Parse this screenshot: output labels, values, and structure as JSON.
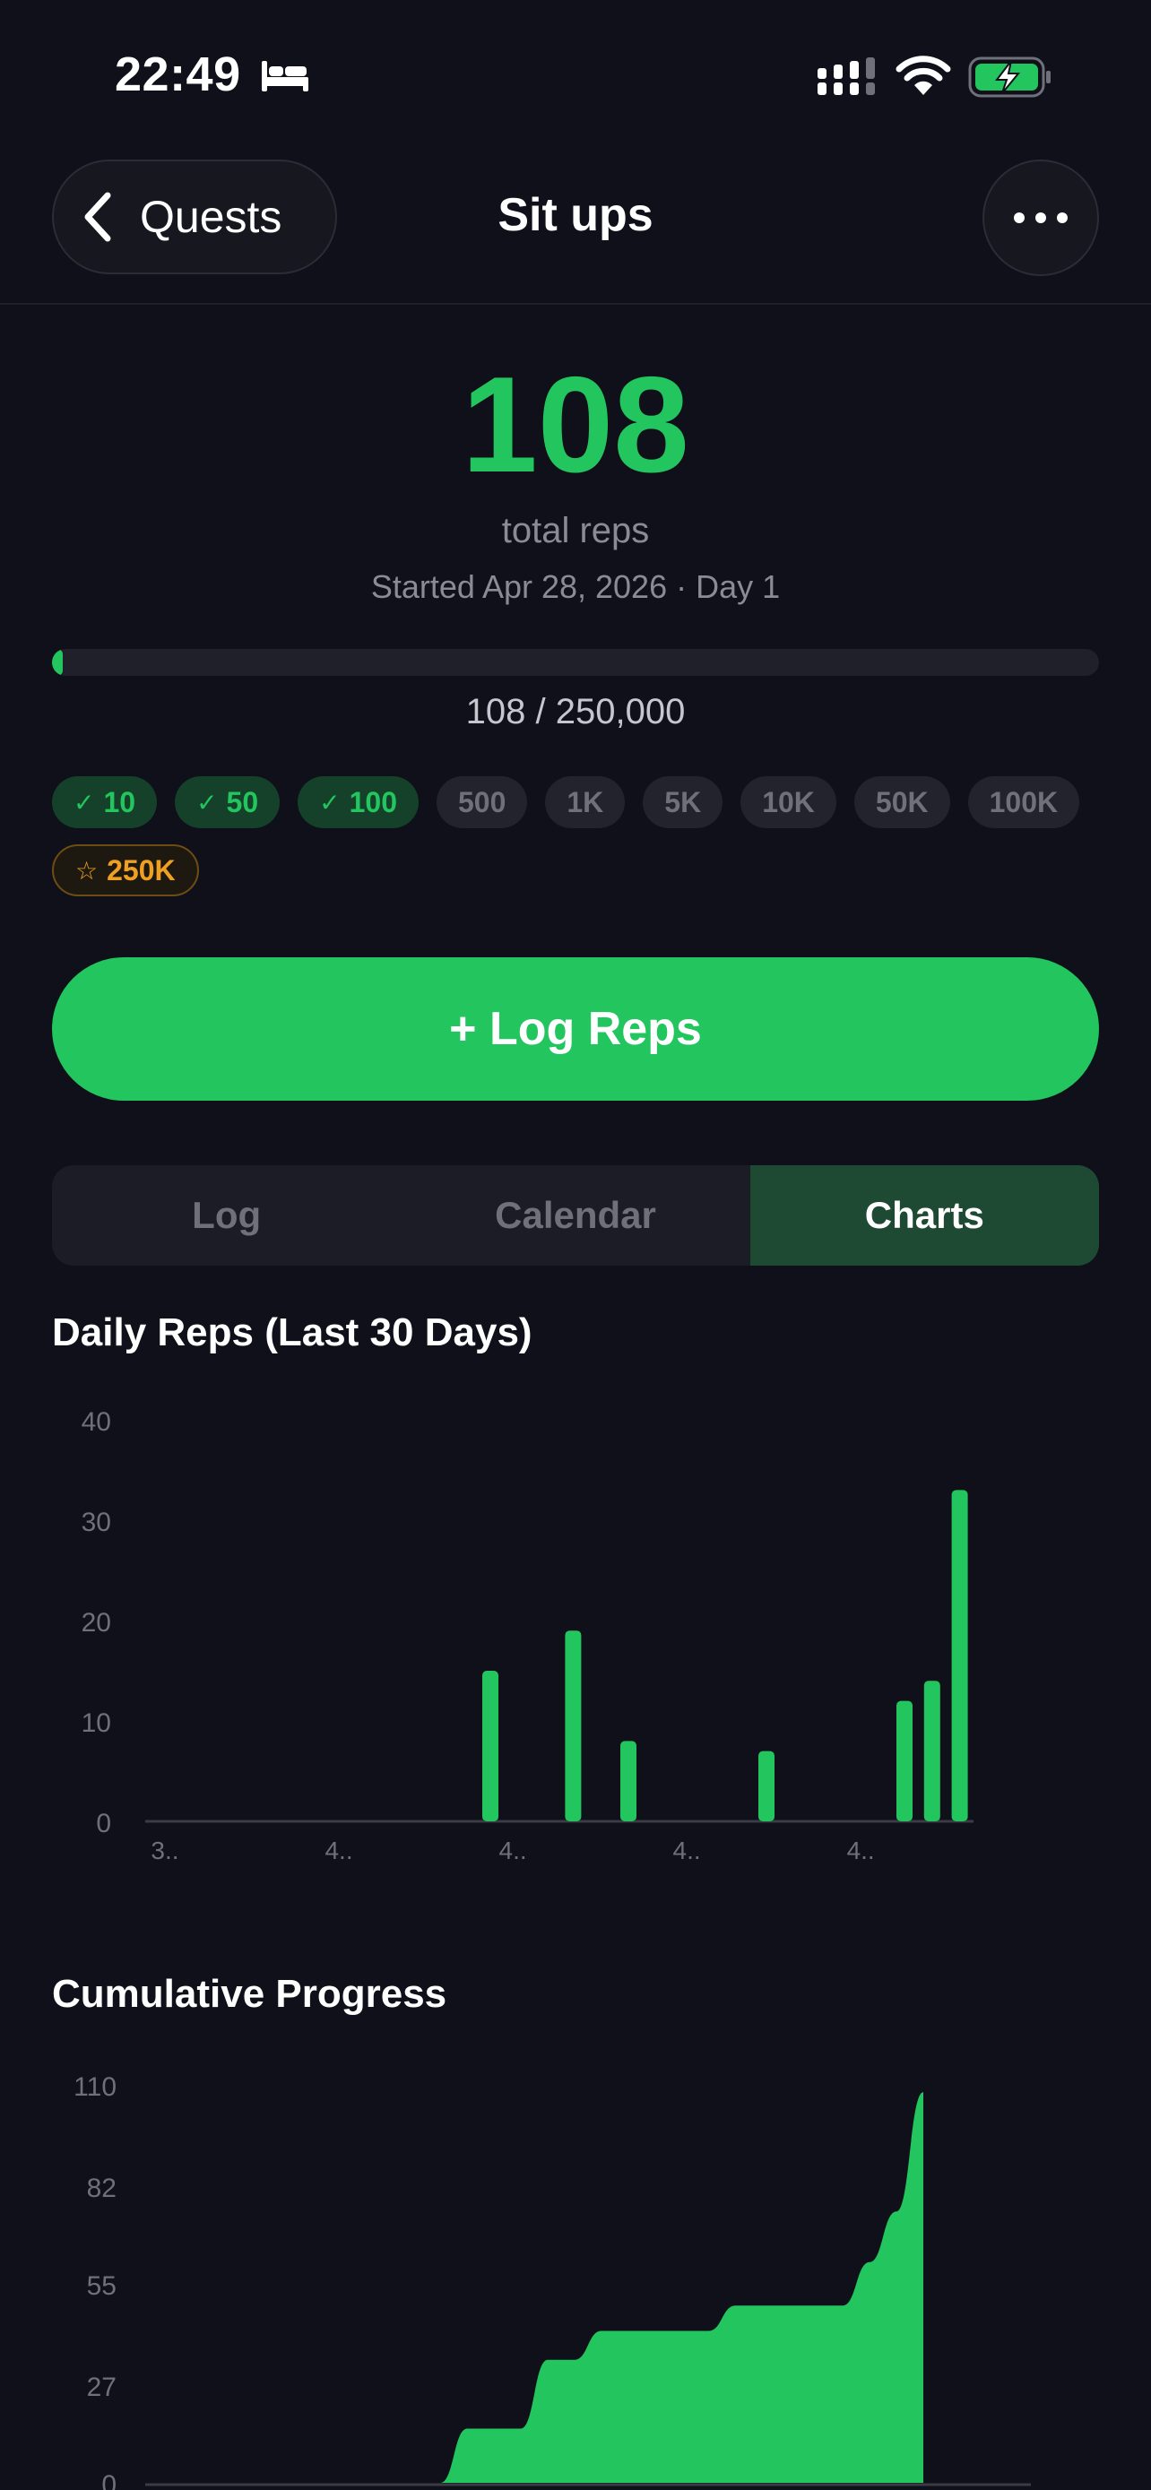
{
  "status_bar": {
    "time": "22:49"
  },
  "header": {
    "back_label": "Quests",
    "title": "Sit ups"
  },
  "hero": {
    "total": "108",
    "total_label": "total reps",
    "started": "Started Apr 28, 2026 · Day 1",
    "progress_text": "108 / 250,000",
    "progress_fraction": 0.000432
  },
  "milestones": [
    {
      "label": "10",
      "state": "done"
    },
    {
      "label": "50",
      "state": "done"
    },
    {
      "label": "100",
      "state": "done"
    },
    {
      "label": "500",
      "state": "locked"
    },
    {
      "label": "1K",
      "state": "locked"
    },
    {
      "label": "5K",
      "state": "locked"
    },
    {
      "label": "10K",
      "state": "locked"
    },
    {
      "label": "50K",
      "state": "locked"
    },
    {
      "label": "100K",
      "state": "locked"
    },
    {
      "label": "250K",
      "state": "goal"
    }
  ],
  "milestone_marks": {
    "done": "✓",
    "goal": "☆"
  },
  "log_button": "+ Log Reps",
  "tabs": [
    {
      "label": "Log",
      "active": false
    },
    {
      "label": "Calendar",
      "active": false
    },
    {
      "label": "Charts",
      "active": true
    }
  ],
  "colors": {
    "accent": "#22c55e",
    "goal": "#f0a020",
    "background": "#0f1019"
  },
  "chart_data": [
    {
      "type": "bar",
      "title": "Daily Reps (Last 30 Days)",
      "ylim": [
        0,
        40
      ],
      "y_ticks": [
        "0",
        "10",
        "20",
        "30",
        "40"
      ],
      "x_tick_labels": [
        "3..",
        "4..",
        "4..",
        "4..",
        "4.."
      ],
      "days": 30,
      "values": [
        0,
        0,
        0,
        0,
        0,
        0,
        0,
        0,
        0,
        0,
        0,
        0,
        15,
        0,
        0,
        19,
        0,
        8,
        0,
        0,
        0,
        0,
        7,
        0,
        0,
        0,
        0,
        12,
        14,
        33
      ],
      "grid": false
    },
    {
      "type": "area",
      "title": "Cumulative Progress",
      "ylim": [
        0,
        110
      ],
      "y_ticks": [
        "0",
        "27",
        "55",
        "82",
        "110"
      ],
      "values": [
        0,
        0,
        0,
        0,
        0,
        0,
        0,
        0,
        0,
        0,
        0,
        0,
        15,
        15,
        15,
        34,
        34,
        42,
        42,
        42,
        42,
        42,
        49,
        49,
        49,
        49,
        49,
        61,
        75,
        108
      ],
      "grid": false
    }
  ]
}
